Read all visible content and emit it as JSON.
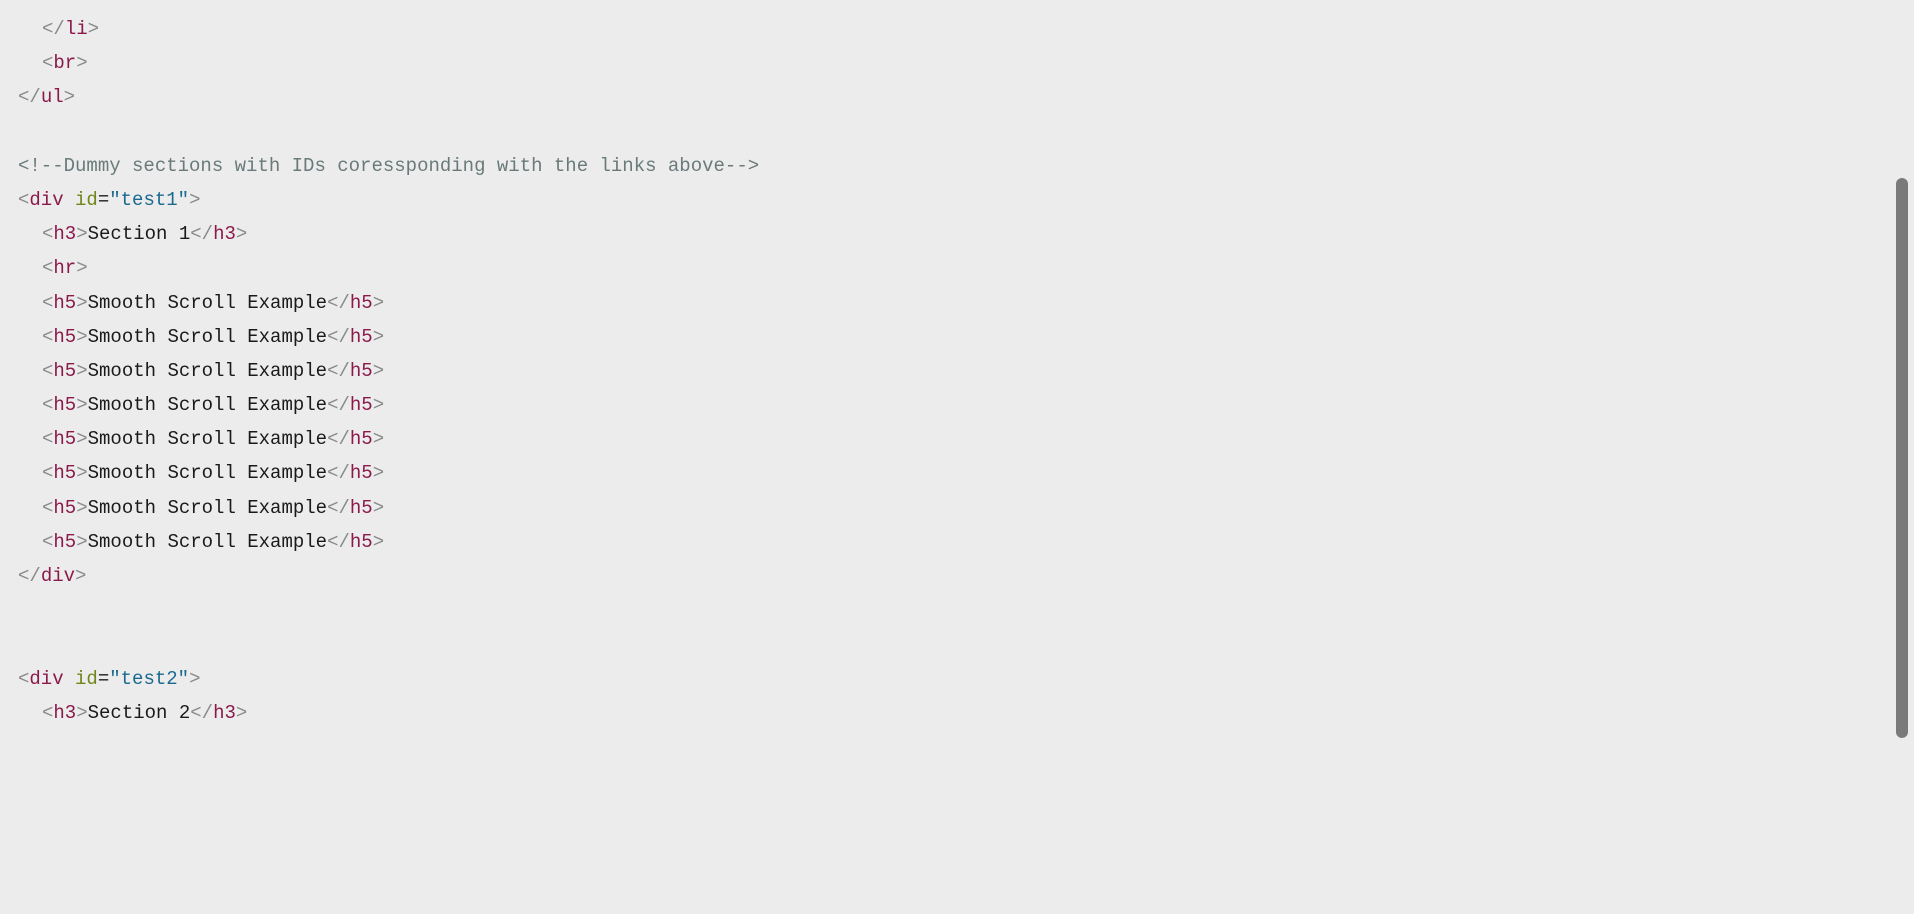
{
  "lines": [
    {
      "indent": 1,
      "t": "close",
      "tag": "li"
    },
    {
      "indent": 1,
      "t": "void",
      "tag": "br"
    },
    {
      "indent": 0,
      "t": "close",
      "tag": "ul"
    },
    {
      "indent": 0,
      "t": "blank"
    },
    {
      "indent": 0,
      "t": "comment",
      "text": "Dummy sections with IDs coressponding with the links above"
    },
    {
      "indent": 0,
      "t": "open-attr",
      "tag": "div",
      "attr": "id",
      "val": "test1"
    },
    {
      "indent": 1,
      "t": "elem",
      "tag": "h3",
      "text": "Section 1"
    },
    {
      "indent": 1,
      "t": "void",
      "tag": "hr"
    },
    {
      "indent": 1,
      "t": "elem",
      "tag": "h5",
      "text": "Smooth Scroll Example"
    },
    {
      "indent": 1,
      "t": "elem",
      "tag": "h5",
      "text": "Smooth Scroll Example"
    },
    {
      "indent": 1,
      "t": "elem",
      "tag": "h5",
      "text": "Smooth Scroll Example"
    },
    {
      "indent": 1,
      "t": "elem",
      "tag": "h5",
      "text": "Smooth Scroll Example"
    },
    {
      "indent": 1,
      "t": "elem",
      "tag": "h5",
      "text": "Smooth Scroll Example"
    },
    {
      "indent": 1,
      "t": "elem",
      "tag": "h5",
      "text": "Smooth Scroll Example"
    },
    {
      "indent": 1,
      "t": "elem",
      "tag": "h5",
      "text": "Smooth Scroll Example"
    },
    {
      "indent": 1,
      "t": "elem",
      "tag": "h5",
      "text": "Smooth Scroll Example"
    },
    {
      "indent": 0,
      "t": "close",
      "tag": "div"
    },
    {
      "indent": 0,
      "t": "blank"
    },
    {
      "indent": 0,
      "t": "blank"
    },
    {
      "indent": 0,
      "t": "open-attr",
      "tag": "div",
      "attr": "id",
      "val": "test2"
    },
    {
      "indent": 1,
      "t": "elem",
      "tag": "h3",
      "text": "Section 2"
    }
  ]
}
